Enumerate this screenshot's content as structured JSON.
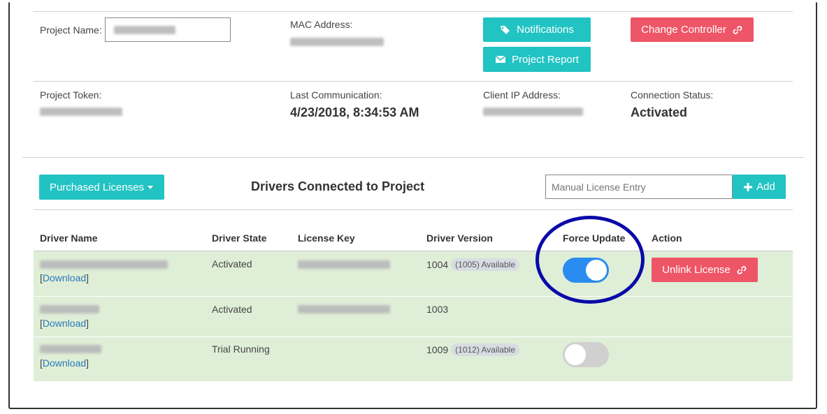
{
  "project": {
    "name_label": "Project Name:",
    "mac_label": "MAC Address:",
    "token_label": "Project Token:",
    "last_comm_label": "Last Communication:",
    "last_comm_value": "4/23/2018, 8:34:53 AM",
    "client_ip_label": "Client IP Address:",
    "conn_status_label": "Connection Status:",
    "conn_status_value": "Activated"
  },
  "buttons": {
    "notifications": "Notifications",
    "project_report": "Project Report",
    "change_controller": "Change Controller",
    "purchased_licenses": "Purchased Licenses",
    "add": "Add",
    "unlink_license": "Unlink License"
  },
  "drivers": {
    "title": "Drivers Connected to Project",
    "license_placeholder": "Manual License Entry",
    "columns": [
      "Driver Name",
      "Driver State",
      "License Key",
      "Driver Version",
      "Force Update",
      "Action"
    ],
    "download_text": "Download",
    "rows": [
      {
        "state": "Activated",
        "version": "1004",
        "available": "(1005) Available",
        "force_update": true,
        "has_action": true
      },
      {
        "state": "Activated",
        "version": "1003",
        "available": "",
        "force_update": null,
        "has_action": false
      },
      {
        "state": "Trial Running",
        "version": "1009",
        "available": "(1012) Available",
        "force_update": false,
        "has_action": false
      }
    ]
  },
  "colors": {
    "teal": "#22c3c3",
    "red": "#ee5566",
    "toggle_on": "#2a8cf0",
    "row_bg": "#dfeed7",
    "highlight_ring": "#0a0aa8"
  },
  "icons": {
    "notifications": "tags-icon",
    "project_report": "envelope-icon",
    "change_controller": "link-icon",
    "add": "plus-icon",
    "unlink": "link-icon",
    "purchased": "caret-down-icon"
  }
}
